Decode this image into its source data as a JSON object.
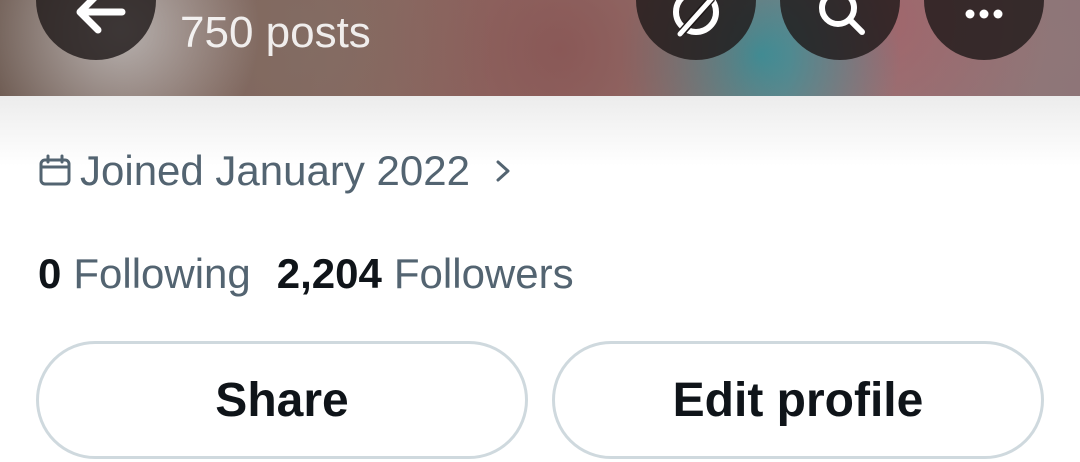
{
  "header": {
    "post_count": "750 posts",
    "buttons": {
      "back": "arrow-left-icon",
      "bot": "grok-icon",
      "search": "search-icon",
      "more": "more-icon"
    }
  },
  "profile": {
    "joined": "Joined January 2022",
    "following_count": "0",
    "following_label": "Following",
    "followers_count": "2,204",
    "followers_label": "Followers"
  },
  "actions": {
    "share_label": "Share",
    "edit_label": "Edit profile"
  },
  "colors": {
    "text_primary": "#0f1419",
    "text_secondary": "#536471",
    "border": "#cfd9de"
  }
}
